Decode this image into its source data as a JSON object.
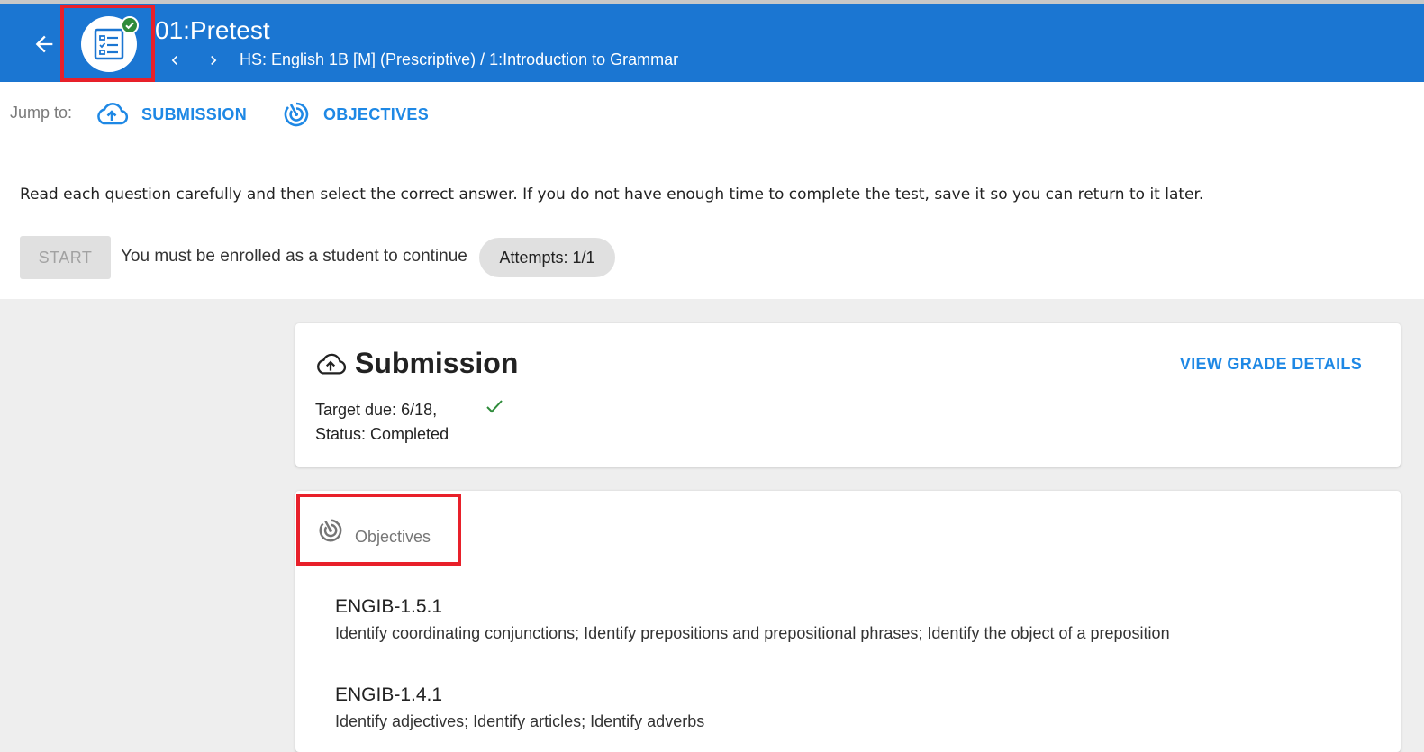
{
  "header": {
    "title": "01:Pretest",
    "breadcrumb": "HS: English 1B [M] (Prescriptive) / 1:Introduction to Grammar",
    "icons": {
      "back": "arrow-left-icon",
      "assignment": "checklist-icon",
      "completed": "check-circle-icon",
      "prev": "chevron-left-icon",
      "next": "chevron-right-icon"
    },
    "colors": {
      "bar": "#1b76d2",
      "completed_badge": "#2e8b3a"
    }
  },
  "jump": {
    "label": "Jump to:",
    "links": [
      {
        "label": "SUBMISSION",
        "icon": "cloud-upload-icon"
      },
      {
        "label": "OBJECTIVES",
        "icon": "target-icon"
      }
    ],
    "link_color": "#1e88e5"
  },
  "intro": {
    "instructions": "Read each question carefully and then select the correct answer. If you do not have enough time to complete the test, save it so you can return to it later.",
    "start_label": "START",
    "enroll_message": "You must be enrolled as a student to continue",
    "attempts": "Attempts: 1/1"
  },
  "submission": {
    "title": "Submission",
    "view_grade_label": "VIEW GRADE DETAILS",
    "target_due": "Target due: 6/18,",
    "status": "Status: Completed",
    "check_color": "#2e8b3a"
  },
  "objectives": {
    "title": "Objectives",
    "items": [
      {
        "code": "ENGIB-1.5.1",
        "description": "Identify coordinating conjunctions; Identify prepositions and prepositional phrases; Identify the object of a preposition"
      },
      {
        "code": "ENGIB-1.4.1",
        "description": "Identify adjectives; Identify articles; Identify adverbs"
      }
    ]
  },
  "annotations": {
    "highlight_color": "#e8202a"
  }
}
